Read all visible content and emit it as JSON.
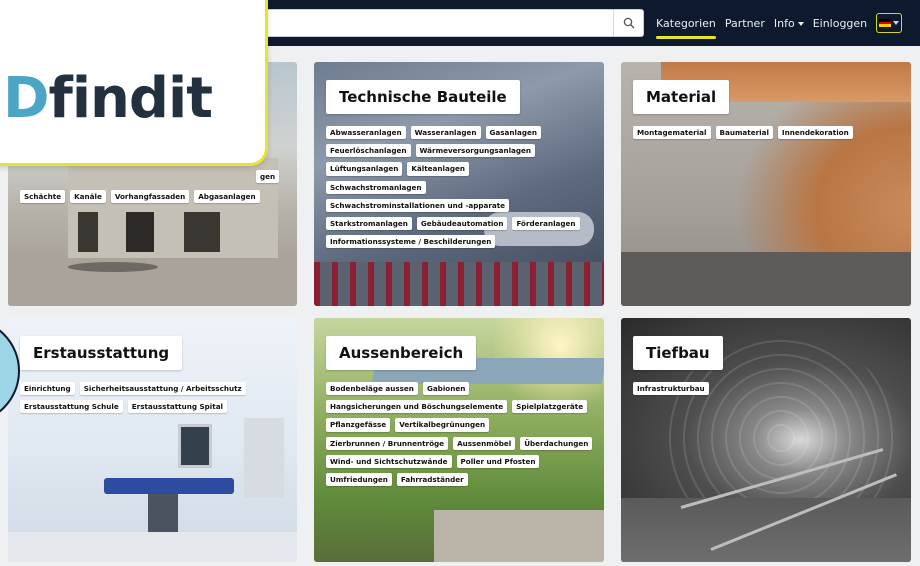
{
  "nav": {
    "search_placeholder": "",
    "links": [
      "Kategorien",
      "Partner",
      "Info",
      "Einloggen"
    ],
    "active_link": "Kategorien",
    "language": "de"
  },
  "logo": {
    "letter": "D",
    "text": "findit"
  },
  "cards": {
    "bau": {
      "tags": [
        "Schächte",
        "Kanäle",
        "Vorhangfassaden",
        "Abgasanlagen"
      ],
      "partial_tag": "gen"
    },
    "technisch": {
      "title": "Technische Bauteile",
      "tags": [
        "Abwasseranlagen",
        "Wasseranlagen",
        "Gasanlagen",
        "Feuerlöschanlagen",
        "Wärmeversorgungsanlagen",
        "Lüftungsanlagen",
        "Kälteanlagen",
        "Schwachstromanlagen",
        "Schwachstrominstallationen und -apparate",
        "Starkstromanlagen",
        "Gebäudeautomation",
        "Förderanlagen",
        "Informationssysteme / Beschilderungen"
      ]
    },
    "material": {
      "title": "Material",
      "tags": [
        "Montagematerial",
        "Baumaterial",
        "Innendekoration"
      ]
    },
    "erstausstattung": {
      "title": "Erstausstattung",
      "tags": [
        "Einrichtung",
        "Sicherheitsausstattung / Arbeitsschutz",
        "Erstausstattung Schule",
        "Erstausstattung Spital"
      ]
    },
    "aussenbereich": {
      "title": "Aussenbereich",
      "tags": [
        "Bodenbeläge aussen",
        "Gabionen",
        "Hangsicherungen und Böschungselemente",
        "Spielplatzgeräte",
        "Pflanzgefässe",
        "Vertikalbegrünungen",
        "Zierbrunnen / Brunnentröge",
        "Aussenmöbel",
        "Überdachungen",
        "Wind- und Sichtschutzwände",
        "Poller und Pfosten",
        "Umfriedungen",
        "Fahrradständer"
      ]
    },
    "tiefbau": {
      "title": "Tiefbau",
      "tags": [
        "Infrastrukturbau"
      ]
    }
  },
  "colors": {
    "nav_bg": "#0d1a2e",
    "accent_yellow": "#e5e62a",
    "logo_blue": "#4aa6c4"
  }
}
